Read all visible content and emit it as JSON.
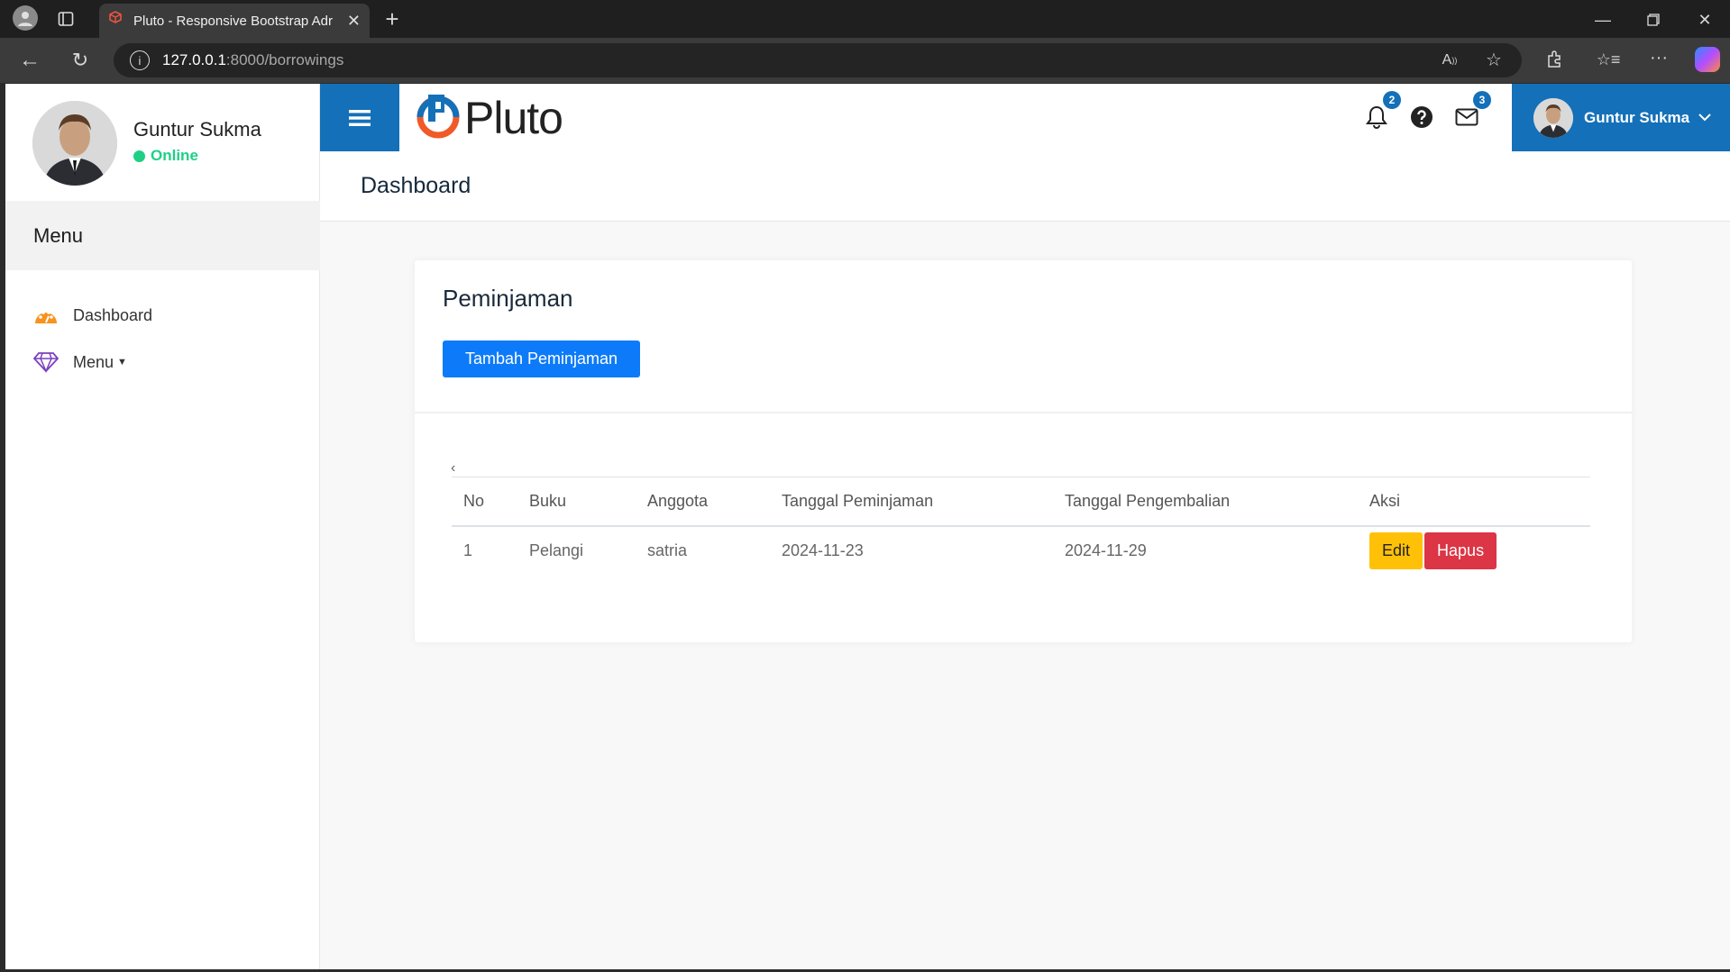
{
  "browser": {
    "tab_title": "Pluto - Responsive Bootstrap Adr",
    "url_host": "127.0.0.1",
    "url_path": ":8000/borrowings"
  },
  "sidebar": {
    "user_name": "Guntur Sukma",
    "status": "Online",
    "menu_heading": "Menu",
    "items": [
      {
        "label": "Dashboard",
        "icon": "dashboard-icon"
      },
      {
        "label": "Menu",
        "icon": "diamond-icon"
      }
    ]
  },
  "topbar": {
    "logo_text": "Pluto",
    "notifications_count": "2",
    "messages_count": "3",
    "user_name": "Guntur Sukma"
  },
  "page": {
    "title": "Dashboard"
  },
  "card": {
    "title": "Peminjaman",
    "add_button": "Tambah Peminjaman",
    "pager_prev": "‹",
    "table": {
      "headers": [
        "No",
        "Buku",
        "Anggota",
        "Tanggal Peminjaman",
        "Tanggal Pengembalian",
        "Aksi"
      ],
      "rows": [
        {
          "no": "1",
          "buku": "Pelangi",
          "anggota": "satria",
          "tanggal_peminjaman": "2024-11-23",
          "tanggal_pengembalian": "2024-11-29",
          "edit_label": "Edit",
          "delete_label": "Hapus"
        }
      ]
    }
  },
  "colors": {
    "brand_blue": "#1470b8",
    "primary_button": "#0d7bf9",
    "warning_button": "#ffc107",
    "danger_button": "#dc3545",
    "online_green": "#1ed085"
  }
}
